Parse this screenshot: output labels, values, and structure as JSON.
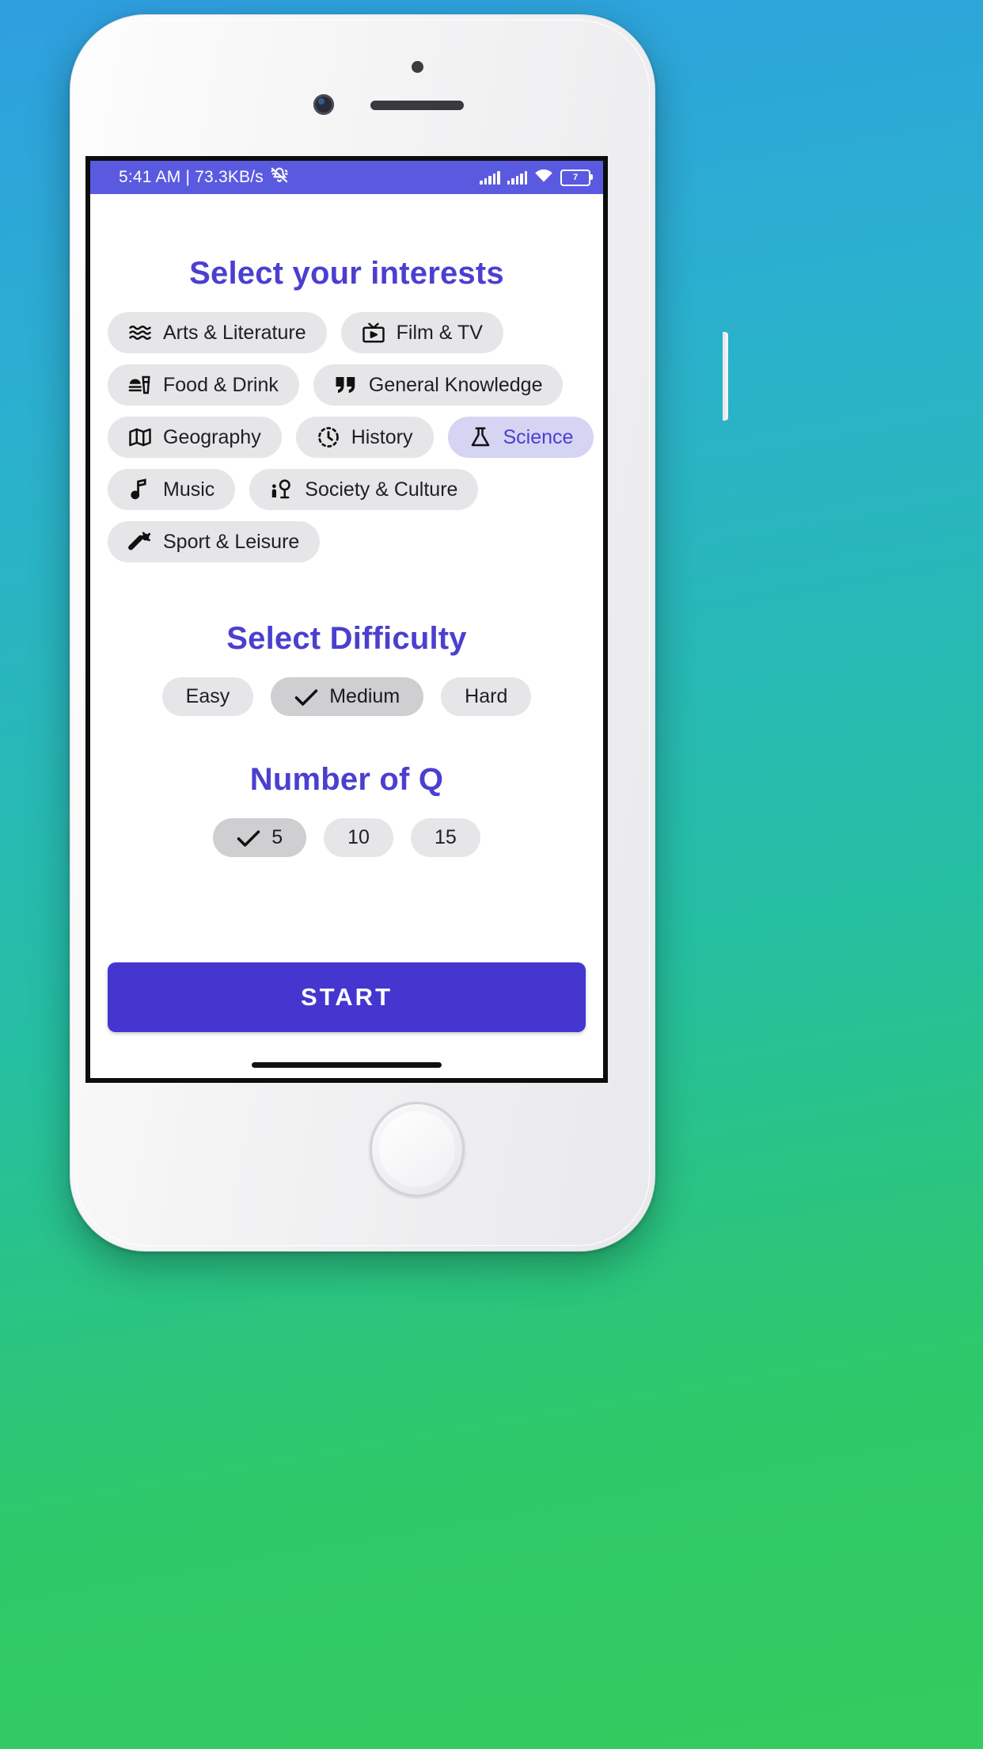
{
  "status_bar": {
    "time_and_network": "5:41 AM | 73.3KB/s",
    "mute_icon": "bell-muted-icon",
    "signal_icon_1": "signal-bars-icon",
    "signal_icon_2": "signal-bars-icon",
    "wifi_icon": "wifi-icon",
    "battery_level": "7",
    "background_color": "#5a5ae0"
  },
  "interests": {
    "title": "Select your interests",
    "rows": [
      [
        {
          "label": "Arts & Literature",
          "icon": "waves-icon",
          "selected": false
        },
        {
          "label": "Film & TV",
          "icon": "television-icon",
          "selected": false
        }
      ],
      [
        {
          "label": "Food & Drink",
          "icon": "burger-drink-icon",
          "selected": false
        },
        {
          "label": "General Knowledge",
          "icon": "quotation-marks-icon",
          "selected": false
        }
      ],
      [
        {
          "label": "Geography",
          "icon": "map-icon",
          "selected": false
        },
        {
          "label": "History",
          "icon": "dashed-clock-icon",
          "selected": false
        },
        {
          "label": "Science",
          "icon": "flask-icon",
          "selected": true
        }
      ],
      [
        {
          "label": "Music",
          "icon": "music-note-icon",
          "selected": false
        },
        {
          "label": "Society & Culture",
          "icon": "people-icon",
          "selected": false
        }
      ],
      [
        {
          "label": "Sport & Leisure",
          "icon": "cricket-bat-ball-icon",
          "selected": false
        }
      ]
    ]
  },
  "difficulty": {
    "title": "Select Difficulty",
    "options": [
      {
        "label": "Easy",
        "selected": false
      },
      {
        "label": "Medium",
        "selected": true
      },
      {
        "label": "Hard",
        "selected": false
      }
    ]
  },
  "number_of_questions": {
    "title": "Number of Q",
    "options": [
      {
        "label": "5",
        "selected": true
      },
      {
        "label": "10",
        "selected": false
      },
      {
        "label": "15",
        "selected": false
      }
    ]
  },
  "actions": {
    "start_label": "START",
    "start_color": "#4436cf"
  },
  "theme": {
    "accent": "#4b3fd0",
    "chip_bg": "#e6e6e8",
    "chip_selected_bg": "#d5d4f3",
    "chip_selected_dark_bg": "#cfcfd1"
  }
}
